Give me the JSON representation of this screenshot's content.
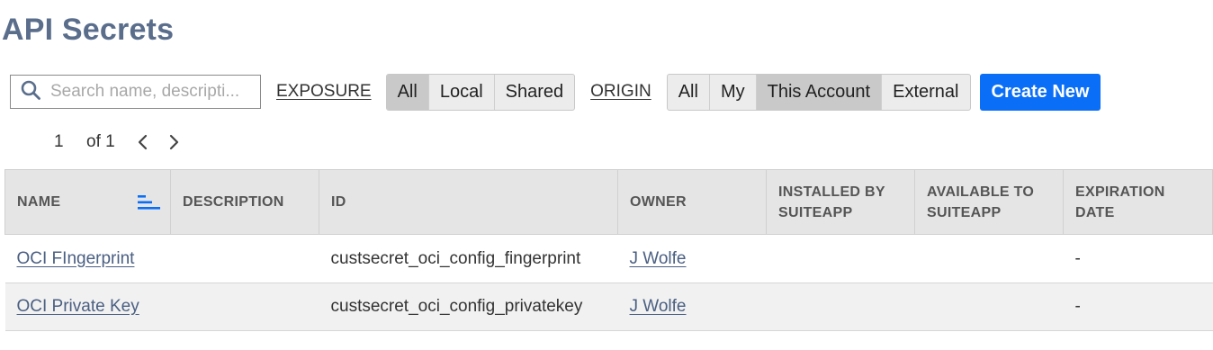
{
  "page": {
    "title": "API Secrets"
  },
  "search": {
    "placeholder": "Search name, descripti...",
    "value": ""
  },
  "filters": {
    "exposure": {
      "label": "EXPOSURE",
      "options": [
        "All",
        "Local",
        "Shared"
      ],
      "selected": "All"
    },
    "origin": {
      "label": "ORIGIN",
      "options": [
        "All",
        "My",
        "This Account",
        "External"
      ],
      "selected": "This Account"
    }
  },
  "create_button": {
    "label": "Create New"
  },
  "pagination": {
    "current": "1",
    "of": "of 1"
  },
  "table": {
    "columns": [
      "NAME",
      "DESCRIPTION",
      "ID",
      "OWNER",
      "INSTALLED BY SUITEAPP",
      "AVAILABLE TO SUITEAPP",
      "EXPIRATION DATE"
    ],
    "rows": [
      {
        "name": "OCI FIngerprint",
        "description": "",
        "id": "custsecret_oci_config_fingerprint",
        "owner": "J Wolfe",
        "installed_by": "",
        "available_to": "",
        "expiration": "-"
      },
      {
        "name": "OCI Private Key",
        "description": "",
        "id": "custsecret_oci_config_privatekey",
        "owner": "J Wolfe",
        "installed_by": "",
        "available_to": "",
        "expiration": "-"
      }
    ]
  },
  "icons": {
    "search": "search-icon",
    "prev": "chevron-left-icon",
    "next": "chevron-right-icon",
    "sort": "sort-icon"
  },
  "colors": {
    "accent": "#0a6ef7",
    "title": "#5a6e8c",
    "link": "#4a5f82"
  }
}
